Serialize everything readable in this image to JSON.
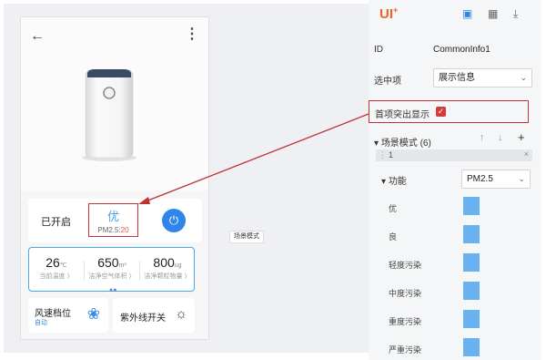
{
  "phone": {
    "status": "已开启",
    "quality": "优",
    "pm_prefix": "PM2.5:",
    "pm_value": "20",
    "metrics": [
      {
        "value": "26",
        "unit": "℃",
        "label": "当前温度 〉"
      },
      {
        "value": "650",
        "unit": "m³",
        "label": "洁净空气体积 〉"
      },
      {
        "value": "800",
        "unit": "ug",
        "label": "洁净颗粒物量 〉"
      }
    ],
    "fan_title": "风速档位",
    "fan_sub": "自动",
    "uv_title": "紫外线开关"
  },
  "scene_tip": "场景模式",
  "panel": {
    "logo": "UI",
    "id_label": "ID",
    "id_value": "CommonInfo1",
    "selected_label": "选中项",
    "selected_value": "展示信息",
    "highlight_label": "首项突出显示",
    "section_label": "场景模式 (6)",
    "item_index": "1",
    "func_label": "功能",
    "func_value": "PM2.5",
    "levels": [
      "优",
      "良",
      "轻度污染",
      "中度污染",
      "重度污染",
      "严重污染"
    ]
  },
  "colors": {
    "accent": "#2f86e8",
    "highlight": "#cc3333",
    "swatch": "#6ab2ef",
    "logo": "#e8622d"
  }
}
